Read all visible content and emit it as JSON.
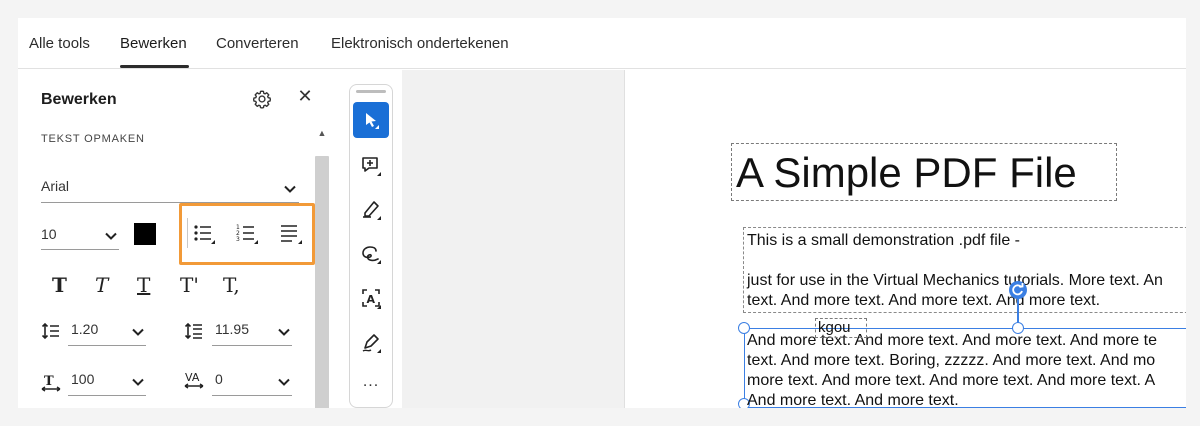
{
  "nav": {
    "tabs": [
      "Alle tools",
      "Bewerken",
      "Converteren",
      "Elektronisch ondertekenen"
    ],
    "active": "Bewerken"
  },
  "panel": {
    "title": "Bewerken",
    "section_label": "TEKST OPMAKEN",
    "font": "Arial",
    "font_size": "10",
    "text_color": "#000000",
    "style_buttons": [
      "T",
      "T",
      "T",
      "T'",
      "T,"
    ],
    "line_spacing": "1.20",
    "paragraph_spacing": "11.95",
    "horizontal_scale": "100",
    "character_spacing": "0"
  },
  "toolbar": {
    "icons": [
      "select-pointer-icon",
      "add-comment-icon",
      "highlight-pen-icon",
      "draw-freehand-icon",
      "text-recognition-icon",
      "sign-icon"
    ],
    "more_label": "..."
  },
  "document": {
    "title": "A Simple PDF File",
    "line1": "This is a small demonstration .pdf file -",
    "line2": "just for use in the Virtual Mechanics tutorials. More text. An",
    "line3": "text. And more text. And more text. And more text.",
    "line4": "And more text. And more text. And more text. And more te",
    "line5": "text. And more text. Boring, zzzzz. And more text. And mo",
    "line6": "more text. And more text. And more text. And more text. A",
    "line7": "And more text. And more text.",
    "inserted_text": "kgou"
  },
  "colors": {
    "accent_blue": "#1a6fd6",
    "highlight_orange": "#f29a38"
  }
}
